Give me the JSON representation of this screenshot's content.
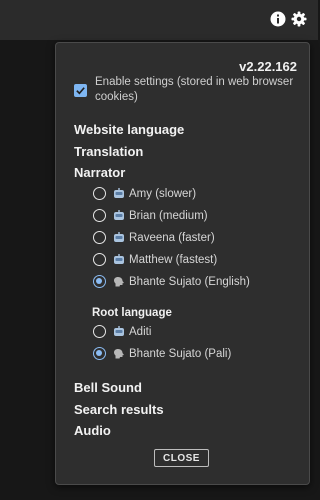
{
  "header": {
    "info_icon": "info-circle-icon",
    "settings_icon": "gear-icon"
  },
  "panel": {
    "version": "v2.22.162",
    "enable_settings": {
      "checked": true,
      "label": "Enable settings (stored in web browser cookies)"
    },
    "sections": {
      "website_language": "Website language",
      "translation": "Translation",
      "narrator": "Narrator",
      "bell_sound": "Bell Sound",
      "search_results": "Search results",
      "audio": "Audio"
    },
    "narrator_options": [
      {
        "label": "Amy (slower)",
        "icon": "robot-icon",
        "selected": false
      },
      {
        "label": "Brian (medium)",
        "icon": "robot-icon",
        "selected": false
      },
      {
        "label": "Raveena (faster)",
        "icon": "robot-icon",
        "selected": false
      },
      {
        "label": "Matthew (fastest)",
        "icon": "robot-icon",
        "selected": false
      },
      {
        "label": "Bhante Sujato (English)",
        "icon": "speaking-head-icon",
        "selected": true
      }
    ],
    "root_language": {
      "title": "Root language",
      "options": [
        {
          "label": "Aditi",
          "icon": "robot-icon",
          "selected": false
        },
        {
          "label": "Bhante Sujato (Pali)",
          "icon": "speaking-head-icon",
          "selected": true
        }
      ]
    },
    "close_label": "CLOSE"
  }
}
